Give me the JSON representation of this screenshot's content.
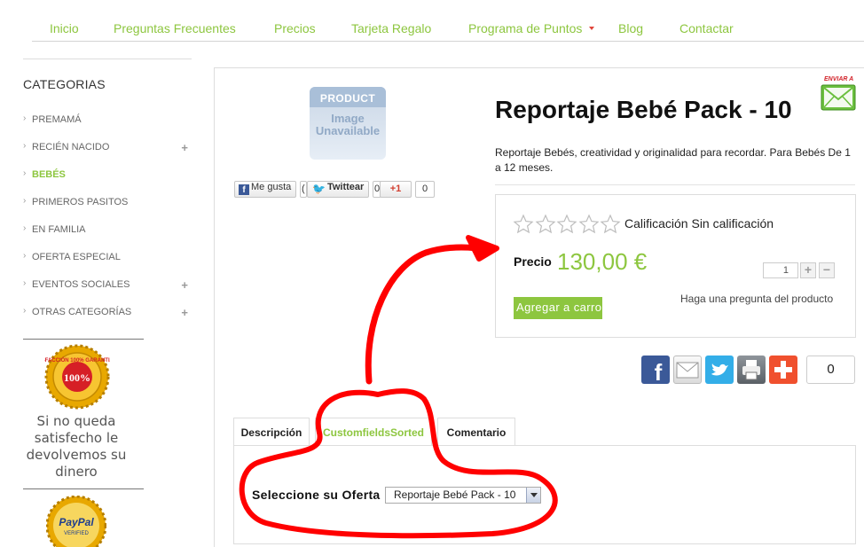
{
  "nav": {
    "items": [
      "Inicio",
      "Preguntas Frecuentes",
      "Precios",
      "Tarjeta Regalo",
      "Programa de Puntos",
      "Blog",
      "Contactar"
    ]
  },
  "sidebar": {
    "title": "CATEGORIAS",
    "items": [
      {
        "label": "PREMAMÁ",
        "expandable": false,
        "active": false
      },
      {
        "label": "RECIÉN NACIDO",
        "expandable": true,
        "active": false
      },
      {
        "label": "BEBÉS",
        "expandable": false,
        "active": true
      },
      {
        "label": "PRIMEROS PASITOS",
        "expandable": false,
        "active": false
      },
      {
        "label": "EN FAMILIA",
        "expandable": false,
        "active": false
      },
      {
        "label": "OFERTA ESPECIAL",
        "expandable": false,
        "active": false
      },
      {
        "label": "EVENTOS SOCIALES",
        "expandable": true,
        "active": false
      },
      {
        "label": "OTRAS CATEGORÍAS",
        "expandable": true,
        "active": false
      }
    ],
    "badge_text": "SATISFACCIÓN 100% GARANTIZADO",
    "satisfaction_text": "Si no queda satisfecho le devolvemos su dinero",
    "paypal_text": "PayPal",
    "paypal_sub": "VERIFIED"
  },
  "product": {
    "image_placeholder": {
      "line1": "PRODUCT",
      "line2": "Image",
      "line3": "Unavailable"
    },
    "title": "Reportaje Bebé Pack - 10",
    "send_label": "ENVIAR A",
    "description": "Reportaje Bebés, creatividad y originalidad para recordar. Para Bebés De 1 a 12 meses.",
    "rating_stars_total": 5,
    "rating_stars_filled": 0,
    "rating_text": "Calificación Sin calificación",
    "price_label": "Precio",
    "price_value": "130,00 €",
    "quantity": "1",
    "qty_plus": "+",
    "qty_minus": "−",
    "add_to_cart": "Agregar a carro",
    "ask_question": "Haga una pregunta del producto"
  },
  "share": {
    "facebook_label": "Me gusta",
    "facebook_count": "(",
    "twitter_label": "Twittear",
    "twitter_count": "0",
    "gplus_label": "+1",
    "gplus_count": "0"
  },
  "social_count": "0",
  "tabs": [
    {
      "label": "Descripción",
      "active": false
    },
    {
      "label": "CustomfieldsSorted",
      "active": true
    },
    {
      "label": "Comentario",
      "active": false
    }
  ],
  "offer": {
    "label": "Seleccione su Oferta",
    "selected": "Reportaje Bebé Pack - 10"
  },
  "colors": {
    "accent": "#8dc63f",
    "annotation": "#ff0000"
  }
}
